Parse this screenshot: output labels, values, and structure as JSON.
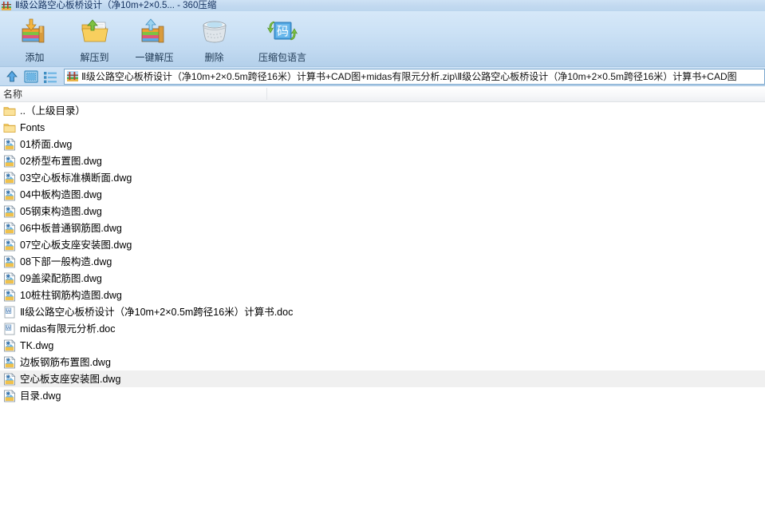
{
  "window": {
    "title": "Ⅱ级公路空心板桥设计（净10m+2×0.5... - 360压缩",
    "title_icon": "bridge-icon"
  },
  "toolbar": {
    "buttons": [
      {
        "label": "添加",
        "icon": "add-archive-icon"
      },
      {
        "label": "解压到",
        "icon": "extract-to-folder-icon"
      },
      {
        "label": "一键解压",
        "icon": "one-click-extract-icon"
      },
      {
        "label": "删除",
        "icon": "trash-icon"
      },
      {
        "label": "压缩包语言",
        "icon": "archive-language-icon"
      }
    ]
  },
  "navbar": {
    "up_icon": "up-arrow-icon",
    "view_icon": "view-panel-icon",
    "list_icon": "list-view-icon",
    "address": {
      "icon": "bridge-icon",
      "value": "Ⅱ级公路空心板桥设计（净10m+2×0.5m跨径16米）计算书+CAD图+midas有限元分析.zip\\Ⅱ级公路空心板桥设计（净10m+2×0.5m跨径16米）计算书+CAD图"
    }
  },
  "columns": {
    "name": "名称"
  },
  "files": [
    {
      "name": "..（上级目录）",
      "icon": "folder-icon",
      "selected": false
    },
    {
      "name": "Fonts",
      "icon": "folder-icon",
      "selected": false
    },
    {
      "name": "01桥面.dwg",
      "icon": "dwg-file-icon",
      "selected": false
    },
    {
      "name": "02桥型布置图.dwg",
      "icon": "dwg-file-icon",
      "selected": false
    },
    {
      "name": "03空心板标准横断面.dwg",
      "icon": "dwg-file-icon",
      "selected": false
    },
    {
      "name": "04中板构造图.dwg",
      "icon": "dwg-file-icon",
      "selected": false
    },
    {
      "name": "05钢束构造图.dwg",
      "icon": "dwg-file-icon",
      "selected": false
    },
    {
      "name": "06中板普通钢筋图.dwg",
      "icon": "dwg-file-icon",
      "selected": false
    },
    {
      "name": "07空心板支座安装图.dwg",
      "icon": "dwg-file-icon",
      "selected": false
    },
    {
      "name": "08下部一般构造.dwg",
      "icon": "dwg-file-icon",
      "selected": false
    },
    {
      "name": "09盖梁配筋图.dwg",
      "icon": "dwg-file-icon",
      "selected": false
    },
    {
      "name": "10桩柱钢筋构造图.dwg",
      "icon": "dwg-file-icon",
      "selected": false
    },
    {
      "name": "Ⅱ级公路空心板桥设计（净10m+2×0.5m跨径16米）计算书.doc",
      "icon": "doc-file-icon",
      "selected": false
    },
    {
      "name": "midas有限元分析.doc",
      "icon": "doc-file-icon",
      "selected": false
    },
    {
      "name": "TK.dwg",
      "icon": "dwg-file-icon",
      "selected": false
    },
    {
      "name": "边板钢筋布置图.dwg",
      "icon": "dwg-file-icon",
      "selected": false
    },
    {
      "name": "空心板支座安装图.dwg",
      "icon": "dwg-file-icon",
      "selected": true
    },
    {
      "name": "目录.dwg",
      "icon": "dwg-file-icon",
      "selected": false
    }
  ],
  "colors": {
    "titlebar": "#c2d9f0",
    "toolbar_top": "#d6e8f8",
    "toolbar_bottom": "#b4d0ea",
    "selection": "#f0f0f0",
    "folder": "#f5d77a",
    "accent_blue": "#3a7cc0"
  }
}
